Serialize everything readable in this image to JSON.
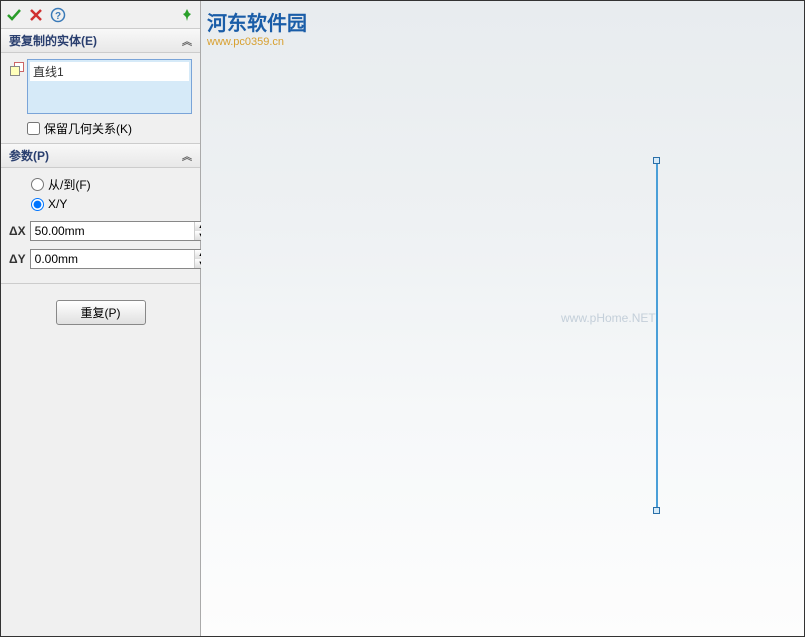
{
  "watermark": {
    "site_name": "河东软件园",
    "site_url": "www.pc0359.cn",
    "center_text": "www.pHome.NET"
  },
  "sections": {
    "entities": {
      "title": "要复制的实体(E)",
      "items": [
        "直线1"
      ],
      "keep_relations_label": "保留几何关系(K)",
      "keep_relations_checked": false
    },
    "params": {
      "title": "参数(P)",
      "mode_fromto_label": "从/到(F)",
      "mode_xy_label": "X/Y",
      "mode_selected": "xy",
      "dx_label": "ΔX",
      "dx_value": "50.00mm",
      "dy_label": "ΔY",
      "dy_value": "0.00mm"
    },
    "repeat_button_label": "重复(P)"
  },
  "icons": {
    "ok": "✓",
    "cancel": "✗",
    "help": "?",
    "pin": "📌"
  }
}
